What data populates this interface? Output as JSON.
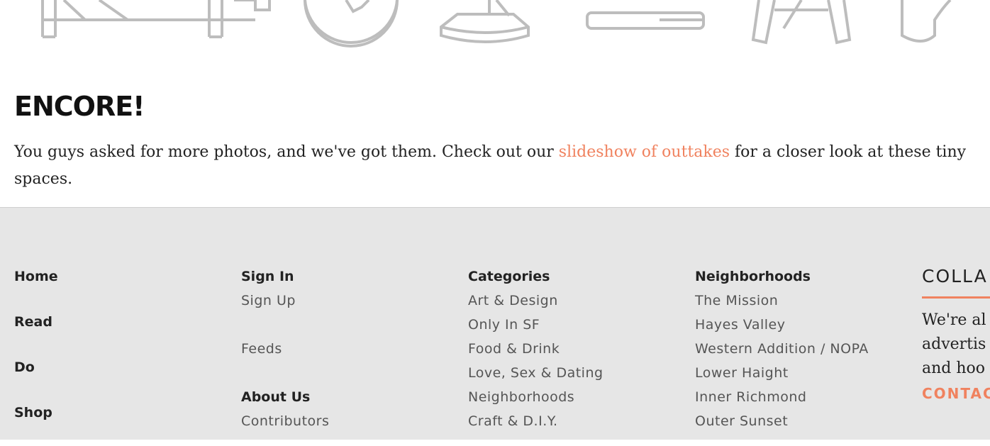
{
  "illustrations": {
    "items": [
      "bed-illustration",
      "plate-illustration",
      "bowl-illustration",
      "spoon-illustration",
      "table-illustration",
      "chair-illustration"
    ]
  },
  "article": {
    "heading": "ENCORE!",
    "text_before": " You guys asked for more photos, and we've got them. Check out our ",
    "link": "slideshow of outtakes",
    "text_after": " for a closer look at these tiny spaces."
  },
  "footer": {
    "main_nav": [
      "Home",
      "Read",
      "Do",
      "Shop"
    ],
    "account": {
      "sign_in": "Sign In",
      "sign_up": "Sign Up",
      "feeds": "Feeds",
      "about": "About Us",
      "contributors": "Contributors"
    },
    "categories": {
      "heading": "Categories",
      "items": [
        "Art & Design",
        "Only In SF",
        "Food & Drink",
        "Love, Sex & Dating",
        "Neighborhoods",
        "Craft & D.I.Y."
      ]
    },
    "neighborhoods": {
      "heading": "Neighborhoods",
      "items": [
        "The Mission",
        "Hayes Valley",
        "Western Addition / NOPA",
        "Lower Haight",
        "Inner Richmond",
        "Outer Sunset"
      ]
    },
    "collab": {
      "title": "COLLA",
      "lines": [
        "We're al",
        "advertis",
        "and hoo"
      ],
      "contact": "CONTAC"
    }
  },
  "colors": {
    "accent": "#f0825f",
    "footer_bg": "#e6e6e6",
    "illustration_stroke": "#bdbdbd"
  }
}
